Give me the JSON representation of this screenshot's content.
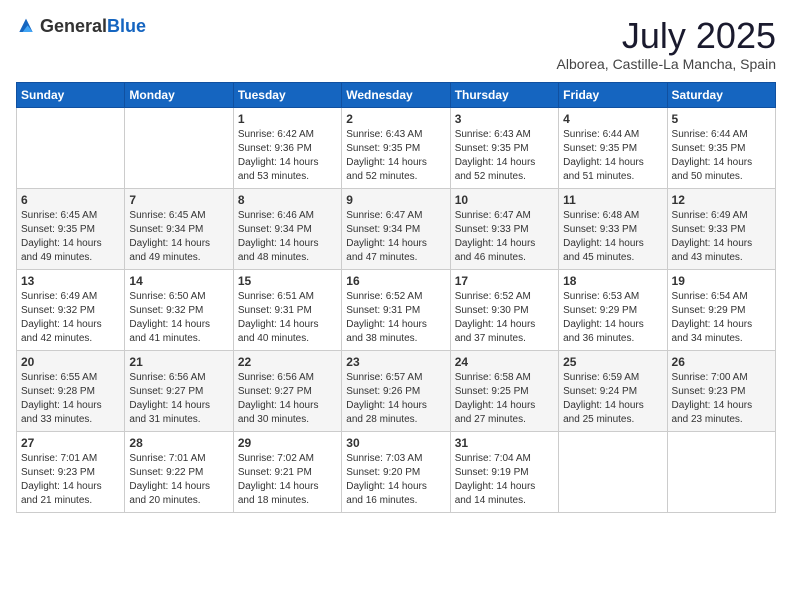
{
  "logo": {
    "general": "General",
    "blue": "Blue"
  },
  "title": {
    "month_year": "July 2025",
    "location": "Alborea, Castille-La Mancha, Spain"
  },
  "days_of_week": [
    "Sunday",
    "Monday",
    "Tuesday",
    "Wednesday",
    "Thursday",
    "Friday",
    "Saturday"
  ],
  "weeks": [
    [
      {
        "day": "",
        "info": ""
      },
      {
        "day": "",
        "info": ""
      },
      {
        "day": "1",
        "info": "Sunrise: 6:42 AM\nSunset: 9:36 PM\nDaylight: 14 hours and 53 minutes."
      },
      {
        "day": "2",
        "info": "Sunrise: 6:43 AM\nSunset: 9:35 PM\nDaylight: 14 hours and 52 minutes."
      },
      {
        "day": "3",
        "info": "Sunrise: 6:43 AM\nSunset: 9:35 PM\nDaylight: 14 hours and 52 minutes."
      },
      {
        "day": "4",
        "info": "Sunrise: 6:44 AM\nSunset: 9:35 PM\nDaylight: 14 hours and 51 minutes."
      },
      {
        "day": "5",
        "info": "Sunrise: 6:44 AM\nSunset: 9:35 PM\nDaylight: 14 hours and 50 minutes."
      }
    ],
    [
      {
        "day": "6",
        "info": "Sunrise: 6:45 AM\nSunset: 9:35 PM\nDaylight: 14 hours and 49 minutes."
      },
      {
        "day": "7",
        "info": "Sunrise: 6:45 AM\nSunset: 9:34 PM\nDaylight: 14 hours and 49 minutes."
      },
      {
        "day": "8",
        "info": "Sunrise: 6:46 AM\nSunset: 9:34 PM\nDaylight: 14 hours and 48 minutes."
      },
      {
        "day": "9",
        "info": "Sunrise: 6:47 AM\nSunset: 9:34 PM\nDaylight: 14 hours and 47 minutes."
      },
      {
        "day": "10",
        "info": "Sunrise: 6:47 AM\nSunset: 9:33 PM\nDaylight: 14 hours and 46 minutes."
      },
      {
        "day": "11",
        "info": "Sunrise: 6:48 AM\nSunset: 9:33 PM\nDaylight: 14 hours and 45 minutes."
      },
      {
        "day": "12",
        "info": "Sunrise: 6:49 AM\nSunset: 9:33 PM\nDaylight: 14 hours and 43 minutes."
      }
    ],
    [
      {
        "day": "13",
        "info": "Sunrise: 6:49 AM\nSunset: 9:32 PM\nDaylight: 14 hours and 42 minutes."
      },
      {
        "day": "14",
        "info": "Sunrise: 6:50 AM\nSunset: 9:32 PM\nDaylight: 14 hours and 41 minutes."
      },
      {
        "day": "15",
        "info": "Sunrise: 6:51 AM\nSunset: 9:31 PM\nDaylight: 14 hours and 40 minutes."
      },
      {
        "day": "16",
        "info": "Sunrise: 6:52 AM\nSunset: 9:31 PM\nDaylight: 14 hours and 38 minutes."
      },
      {
        "day": "17",
        "info": "Sunrise: 6:52 AM\nSunset: 9:30 PM\nDaylight: 14 hours and 37 minutes."
      },
      {
        "day": "18",
        "info": "Sunrise: 6:53 AM\nSunset: 9:29 PM\nDaylight: 14 hours and 36 minutes."
      },
      {
        "day": "19",
        "info": "Sunrise: 6:54 AM\nSunset: 9:29 PM\nDaylight: 14 hours and 34 minutes."
      }
    ],
    [
      {
        "day": "20",
        "info": "Sunrise: 6:55 AM\nSunset: 9:28 PM\nDaylight: 14 hours and 33 minutes."
      },
      {
        "day": "21",
        "info": "Sunrise: 6:56 AM\nSunset: 9:27 PM\nDaylight: 14 hours and 31 minutes."
      },
      {
        "day": "22",
        "info": "Sunrise: 6:56 AM\nSunset: 9:27 PM\nDaylight: 14 hours and 30 minutes."
      },
      {
        "day": "23",
        "info": "Sunrise: 6:57 AM\nSunset: 9:26 PM\nDaylight: 14 hours and 28 minutes."
      },
      {
        "day": "24",
        "info": "Sunrise: 6:58 AM\nSunset: 9:25 PM\nDaylight: 14 hours and 27 minutes."
      },
      {
        "day": "25",
        "info": "Sunrise: 6:59 AM\nSunset: 9:24 PM\nDaylight: 14 hours and 25 minutes."
      },
      {
        "day": "26",
        "info": "Sunrise: 7:00 AM\nSunset: 9:23 PM\nDaylight: 14 hours and 23 minutes."
      }
    ],
    [
      {
        "day": "27",
        "info": "Sunrise: 7:01 AM\nSunset: 9:23 PM\nDaylight: 14 hours and 21 minutes."
      },
      {
        "day": "28",
        "info": "Sunrise: 7:01 AM\nSunset: 9:22 PM\nDaylight: 14 hours and 20 minutes."
      },
      {
        "day": "29",
        "info": "Sunrise: 7:02 AM\nSunset: 9:21 PM\nDaylight: 14 hours and 18 minutes."
      },
      {
        "day": "30",
        "info": "Sunrise: 7:03 AM\nSunset: 9:20 PM\nDaylight: 14 hours and 16 minutes."
      },
      {
        "day": "31",
        "info": "Sunrise: 7:04 AM\nSunset: 9:19 PM\nDaylight: 14 hours and 14 minutes."
      },
      {
        "day": "",
        "info": ""
      },
      {
        "day": "",
        "info": ""
      }
    ]
  ]
}
